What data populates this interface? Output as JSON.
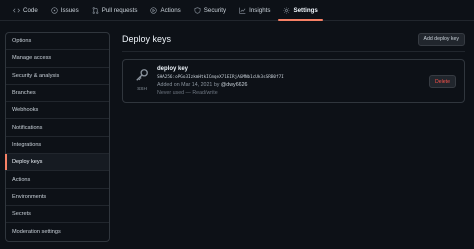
{
  "repo_nav": {
    "tabs": [
      {
        "label": "Code",
        "icon": "code-icon"
      },
      {
        "label": "Issues",
        "icon": "issue-icon"
      },
      {
        "label": "Pull requests",
        "icon": "pull-request-icon"
      },
      {
        "label": "Actions",
        "icon": "play-icon"
      },
      {
        "label": "Security",
        "icon": "shield-icon"
      },
      {
        "label": "Insights",
        "icon": "graph-icon"
      },
      {
        "label": "Settings",
        "icon": "gear-icon",
        "active": true
      }
    ]
  },
  "sidebar": {
    "items": [
      {
        "label": "Options"
      },
      {
        "label": "Manage access"
      },
      {
        "label": "Security & analysis"
      },
      {
        "label": "Branches"
      },
      {
        "label": "Webhooks"
      },
      {
        "label": "Notifications"
      },
      {
        "label": "Integrations"
      },
      {
        "label": "Deploy keys",
        "active": true
      },
      {
        "label": "Actions"
      },
      {
        "label": "Environments"
      },
      {
        "label": "Secrets"
      },
      {
        "label": "Moderation settings"
      }
    ]
  },
  "main": {
    "title": "Deploy keys",
    "add_button": "Add deploy key",
    "key": {
      "title": "deploy key",
      "type": "SSH",
      "fingerprint": "SHA256:oPGo3IzkmHtkICmqeX71EIRjAGMNb1cUk3sSRB0f7I",
      "added_prefix": "Added on Mar 14, 2021 by ",
      "added_user": "@dwy6626",
      "usage": "Never used — Read/write",
      "delete_button": "Delete"
    }
  },
  "colors": {
    "background": "#0d1117",
    "accent": "#f78166",
    "danger": "#f85149",
    "border": "#30363d"
  }
}
